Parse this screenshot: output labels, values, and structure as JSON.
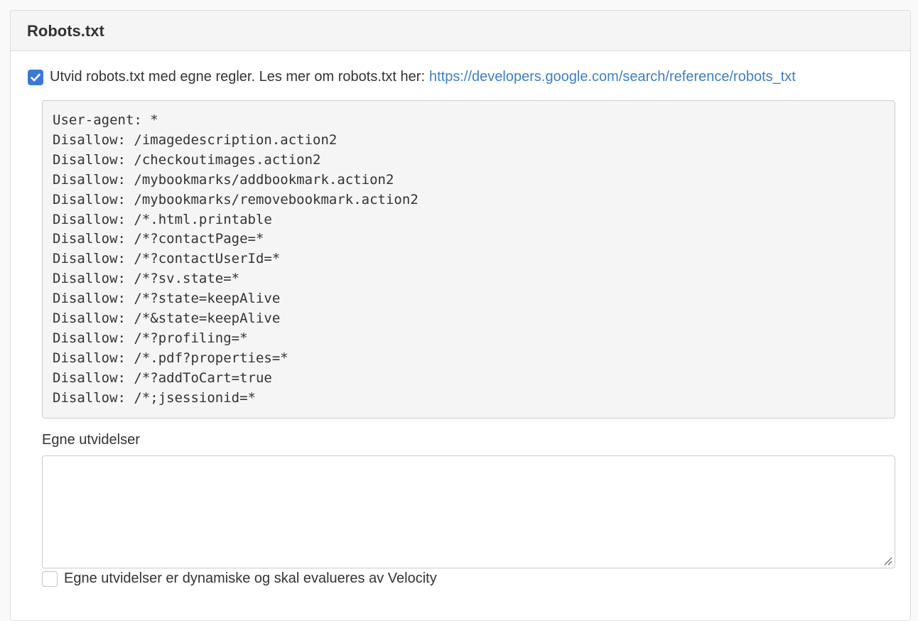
{
  "panel": {
    "title": "Robots.txt"
  },
  "extend": {
    "checked": true,
    "label": "Utvid robots.txt med egne regler. Les mer om robots.txt her:",
    "link_text": "https://developers.google.com/search/reference/robots_txt"
  },
  "default_rules": [
    "User-agent: *",
    "Disallow: /imagedescription.action2",
    "Disallow: /checkoutimages.action2",
    "Disallow: /mybookmarks/addbookmark.action2",
    "Disallow: /mybookmarks/removebookmark.action2",
    "Disallow: /*.html.printable",
    "Disallow: /*?contactPage=*",
    "Disallow: /*?contactUserId=*",
    "Disallow: /*?sv.state=*",
    "Disallow: /*?state=keepAlive",
    "Disallow: /*&state=keepAlive",
    "Disallow: /*?profiling=*",
    "Disallow: /*.pdf?properties=*",
    "Disallow: /*?addToCart=true",
    "Disallow: /*;jsessionid=*"
  ],
  "custom": {
    "label": "Egne utvidelser",
    "value": ""
  },
  "dynamic": {
    "checked": false,
    "label": "Egne utvidelser er dynamiske og skal evalueres av Velocity"
  },
  "colors": {
    "accent": "#3a78d6",
    "link": "#3f7fc7",
    "heading_bg": "#f5f5f5",
    "code_bg": "#f5f5f5"
  }
}
